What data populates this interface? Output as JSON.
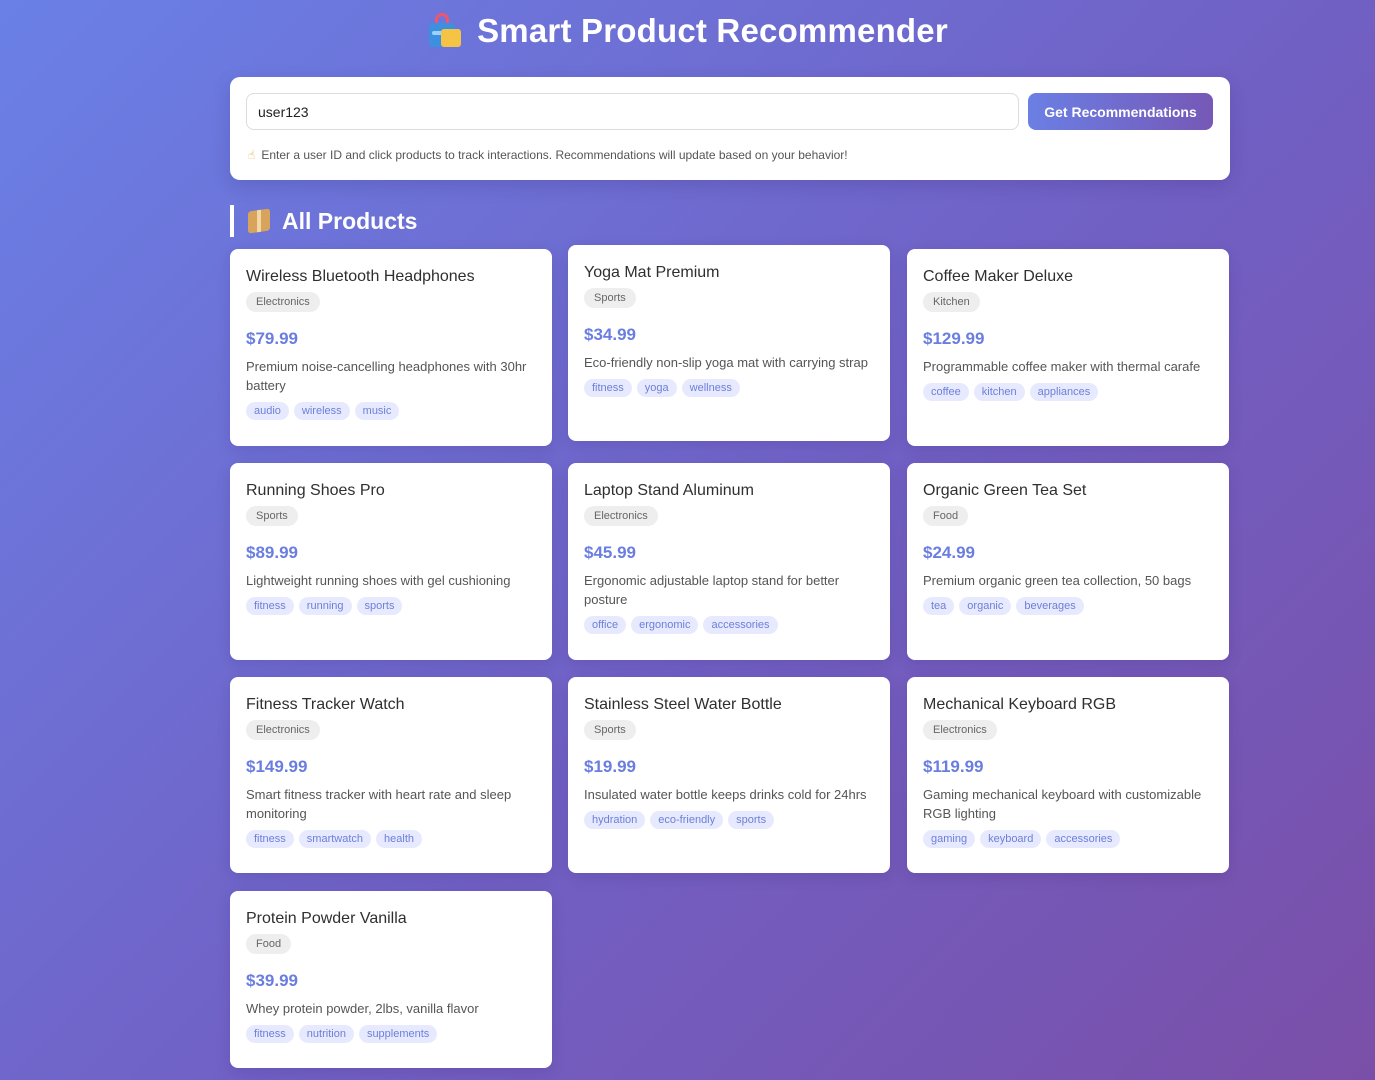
{
  "header": {
    "title": "Smart Product Recommender",
    "icon": "shopping-bags-icon"
  },
  "search": {
    "value": "user123",
    "placeholder": "",
    "button_label": "Get Recommendations",
    "hint": "Enter a user ID and click products to track interactions. Recommendations will update based on your behavior!",
    "hint_icon": "pointing-hand-icon"
  },
  "section": {
    "title": "All Products",
    "icon": "package-icon"
  },
  "colors": {
    "accent": "#6a7de0",
    "tag_bg": "#e7eaff",
    "background_start": "#6a80e6",
    "background_end": "#7a4fa8"
  },
  "products": [
    {
      "name": "Wireless Bluetooth Headphones",
      "category": "Electronics",
      "price": "$79.99",
      "description": "Premium noise-cancelling headphones with 30hr battery",
      "tags": [
        "audio",
        "wireless",
        "music"
      ]
    },
    {
      "name": "Yoga Mat Premium",
      "category": "Sports",
      "price": "$34.99",
      "description": "Eco-friendly non-slip yoga mat with carrying strap",
      "tags": [
        "fitness",
        "yoga",
        "wellness"
      ]
    },
    {
      "name": "Coffee Maker Deluxe",
      "category": "Kitchen",
      "price": "$129.99",
      "description": "Programmable coffee maker with thermal carafe",
      "tags": [
        "coffee",
        "kitchen",
        "appliances"
      ]
    },
    {
      "name": "Running Shoes Pro",
      "category": "Sports",
      "price": "$89.99",
      "description": "Lightweight running shoes with gel cushioning",
      "tags": [
        "fitness",
        "running",
        "sports"
      ]
    },
    {
      "name": "Laptop Stand Aluminum",
      "category": "Electronics",
      "price": "$45.99",
      "description": "Ergonomic adjustable laptop stand for better posture",
      "tags": [
        "office",
        "ergonomic",
        "accessories"
      ]
    },
    {
      "name": "Organic Green Tea Set",
      "category": "Food",
      "price": "$24.99",
      "description": "Premium organic green tea collection, 50 bags",
      "tags": [
        "tea",
        "organic",
        "beverages"
      ]
    },
    {
      "name": "Fitness Tracker Watch",
      "category": "Electronics",
      "price": "$149.99",
      "description": "Smart fitness tracker with heart rate and sleep monitoring",
      "tags": [
        "fitness",
        "smartwatch",
        "health"
      ]
    },
    {
      "name": "Stainless Steel Water Bottle",
      "category": "Sports",
      "price": "$19.99",
      "description": "Insulated water bottle keeps drinks cold for 24hrs",
      "tags": [
        "hydration",
        "eco-friendly",
        "sports"
      ]
    },
    {
      "name": "Mechanical Keyboard RGB",
      "category": "Electronics",
      "price": "$119.99",
      "description": "Gaming mechanical keyboard with customizable RGB lighting",
      "tags": [
        "gaming",
        "keyboard",
        "accessories"
      ]
    },
    {
      "name": "Protein Powder Vanilla",
      "category": "Food",
      "price": "$39.99",
      "description": "Whey protein powder, 2lbs, vanilla flavor",
      "tags": [
        "fitness",
        "nutrition",
        "supplements"
      ]
    }
  ]
}
